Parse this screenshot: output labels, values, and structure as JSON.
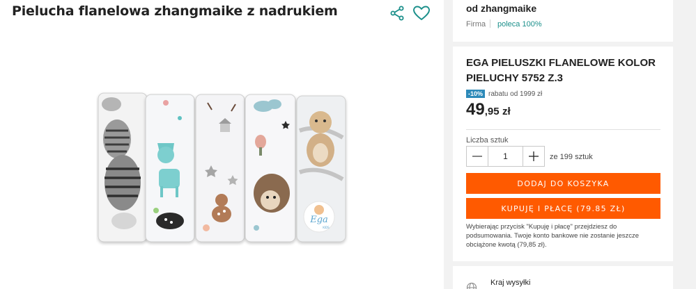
{
  "product": {
    "title": "Pielucha flanelowa zhangmaike z nadrukiem"
  },
  "icons": {
    "share": "share-icon",
    "favorite": "heart-icon",
    "globe": "globe-icon",
    "minus": "minus-icon",
    "plus": "plus-icon"
  },
  "seller": {
    "name": "od zhangmaike",
    "type": "Firma",
    "recommend": "poleca 100%"
  },
  "offer": {
    "title": "EGA PIELUSZKI FLANELOWE KOLOR PIELUCHY 5752 Z.3",
    "discount_badge": "-10%",
    "discount_text": "rabatu od 1999 zł",
    "price_int": "49",
    "price_dec": ",95",
    "price_currency": "zł"
  },
  "quantity": {
    "label": "Liczba sztuk",
    "value": "1",
    "of_text": "ze 199 sztuk"
  },
  "buttons": {
    "add_to_cart": "DODAJ DO KOSZYKA",
    "buy_now": "KUPUJĘ I PŁACĘ (79.85 ZŁ)"
  },
  "buy_note": "Wybierając przycisk \"Kupuję i płacę\" przejdziesz do podsumowania. Twoje konto bankowe nie zostanie jeszcze obciążone kwotą (79,85 zł).",
  "shipping": {
    "label": "Kraj wysyłki"
  },
  "image_brand": {
    "logo_text": "Ega",
    "logo_sub": "KIDS"
  },
  "colors": {
    "accent": "#ff5a00",
    "badge": "#2d8ab9",
    "link": "#1a8f8a"
  }
}
